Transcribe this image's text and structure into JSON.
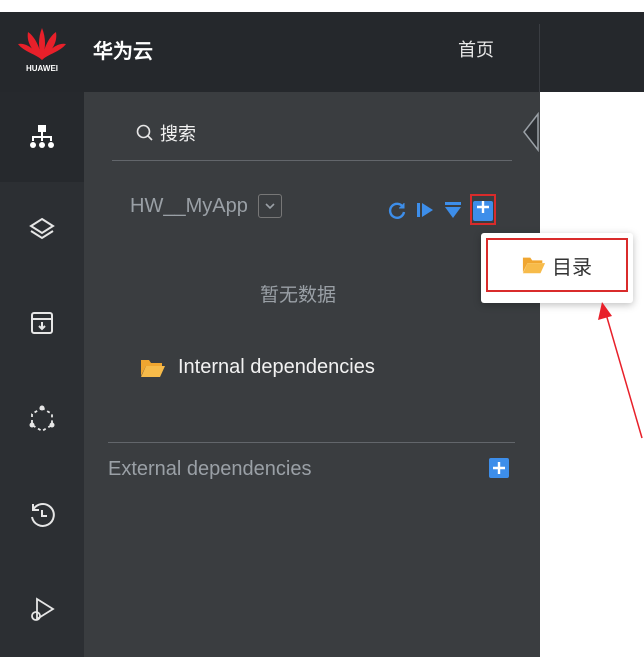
{
  "header": {
    "logo_text": "HUAWEI",
    "brand": "华为云",
    "home": "首页"
  },
  "rail": {
    "icons": [
      "hierarchy-icon",
      "layers-icon",
      "archive-icon",
      "hexagon-nodes-icon",
      "history-icon",
      "debug-play-icon"
    ]
  },
  "panel": {
    "search_label": "搜索",
    "project_name": "HW__MyApp",
    "empty_text": "暂无数据",
    "internal_label": "Internal dependencies",
    "external_label": "External dependencies"
  },
  "popup": {
    "item_label": "目录"
  },
  "colors": {
    "accent": "#3d8eea",
    "highlight": "#d92b2b",
    "folder": "#f0a630"
  }
}
